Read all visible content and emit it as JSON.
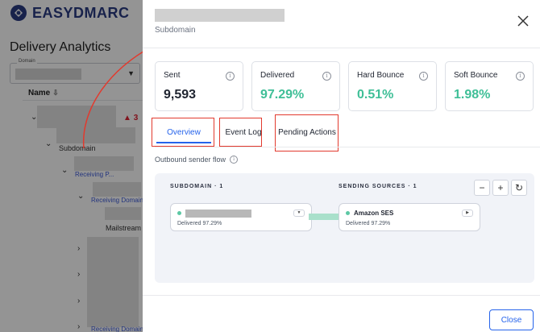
{
  "brand": {
    "name": "EASYDMARC"
  },
  "background": {
    "title": "Delivery Analytics",
    "domain_select_label": "Domain",
    "name_column": "Name",
    "row_labels": [
      "Subdomain",
      "Receiving P...",
      "Receiving Domain",
      "Mailstream",
      "Receiving Domain"
    ],
    "warning_count": "3"
  },
  "drawer": {
    "subtitle": "Subdomain",
    "stats": [
      {
        "label": "Sent",
        "value": "9,593",
        "color": "#1f2430"
      },
      {
        "label": "Delivered",
        "value": "97.29%",
        "color": "#3fbf97"
      },
      {
        "label": "Hard Bounce",
        "value": "0.51%",
        "color": "#3fbf97"
      },
      {
        "label": "Soft Bounce",
        "value": "1.98%",
        "color": "#3fbf97"
      }
    ],
    "tabs": [
      {
        "label": "Overview",
        "active": true
      },
      {
        "label": "Event Log",
        "active": false
      },
      {
        "label": "Pending Actions",
        "active": false
      }
    ],
    "flow": {
      "title": "Outbound sender flow",
      "left_column": "SUBDOMAIN · 1",
      "right_column": "SENDING SOURCES · 1",
      "controls": [
        "−",
        "+",
        "↻"
      ],
      "subdomain_node": {
        "sub": "Delivered 97.29%"
      },
      "source_node": {
        "name": "Amazon SES",
        "sub": "Delivered 97.29%"
      }
    },
    "close_label": "Close"
  },
  "colors": {
    "accent": "#2563eb",
    "success": "#3fbf97",
    "annotation": "#e23a2e"
  }
}
